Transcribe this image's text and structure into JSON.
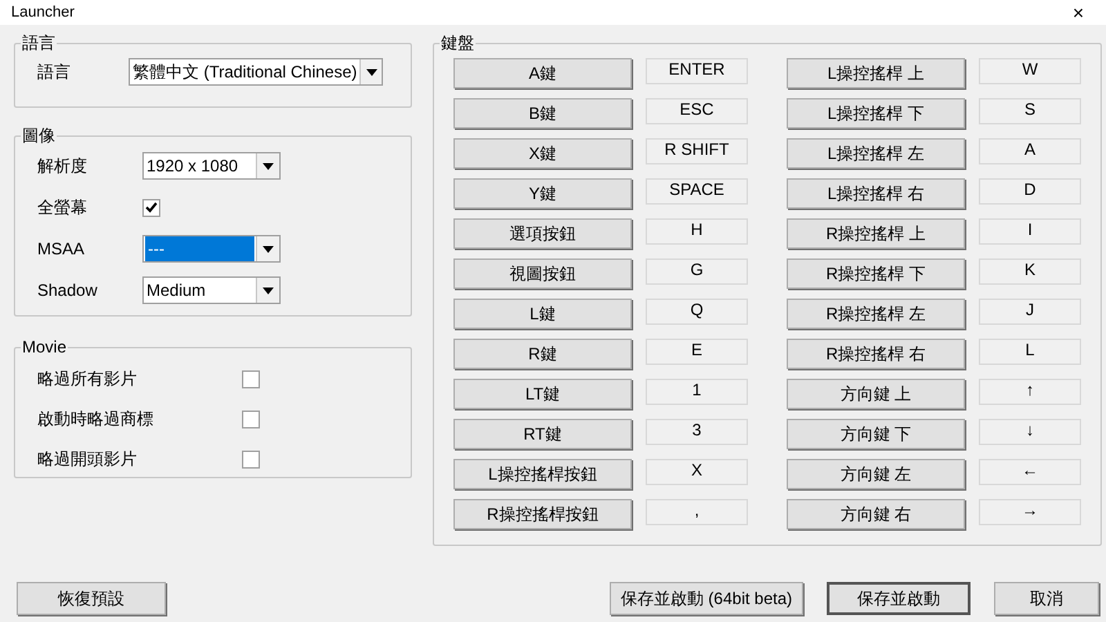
{
  "window": {
    "title": "Launcher",
    "close": "×"
  },
  "language": {
    "legend": "語言",
    "label": "語言",
    "value": "繁體中文 (Traditional Chinese)",
    "highlighted": false
  },
  "graphics": {
    "legend": "圖像",
    "fields": [
      {
        "kind": "dropdown",
        "label": "解析度",
        "value": "1920 x 1080",
        "highlighted": false
      },
      {
        "kind": "checkbox",
        "label": "全螢幕",
        "checked": true
      },
      {
        "kind": "dropdown",
        "label": "MSAA",
        "value": "---",
        "highlighted": true
      },
      {
        "kind": "dropdown",
        "label": "Shadow",
        "value": "Medium",
        "highlighted": false
      }
    ]
  },
  "movie": {
    "legend": "Movie",
    "options": [
      {
        "label": "略過所有影片",
        "checked": false
      },
      {
        "label": "啟動時略過商標",
        "checked": false
      },
      {
        "label": "略過開頭影片",
        "checked": false
      }
    ]
  },
  "keyboard": {
    "legend": "鍵盤",
    "columns": [
      [
        {
          "action": "A鍵",
          "key": "ENTER"
        },
        {
          "action": "B鍵",
          "key": "ESC"
        },
        {
          "action": "X鍵",
          "key": "R SHIFT"
        },
        {
          "action": "Y鍵",
          "key": "SPACE"
        },
        {
          "action": "選項按鈕",
          "key": "H"
        },
        {
          "action": "視圖按鈕",
          "key": "G"
        },
        {
          "action": "L鍵",
          "key": "Q"
        },
        {
          "action": "R鍵",
          "key": "E"
        },
        {
          "action": "LT鍵",
          "key": "1"
        },
        {
          "action": "RT鍵",
          "key": "3"
        },
        {
          "action": "L操控搖桿按鈕",
          "key": "X"
        },
        {
          "action": "R操控搖桿按鈕",
          "key": ","
        }
      ],
      [
        {
          "action": "L操控搖桿 上",
          "key": "W"
        },
        {
          "action": "L操控搖桿 下",
          "key": "S"
        },
        {
          "action": "L操控搖桿 左",
          "key": "A"
        },
        {
          "action": "L操控搖桿 右",
          "key": "D"
        },
        {
          "action": "R操控搖桿 上",
          "key": "I"
        },
        {
          "action": "R操控搖桿 下",
          "key": "K"
        },
        {
          "action": "R操控搖桿 左",
          "key": "J"
        },
        {
          "action": "R操控搖桿 右",
          "key": "L"
        },
        {
          "action": "方向鍵 上",
          "key": "↑"
        },
        {
          "action": "方向鍵 下",
          "key": "↓"
        },
        {
          "action": "方向鍵 左",
          "key": "←"
        },
        {
          "action": "方向鍵 右",
          "key": "→"
        }
      ]
    ]
  },
  "buttons": {
    "reset": "恢復預設",
    "save_64": "保存並啟動 (64bit beta)",
    "save": "保存並啟動",
    "cancel": "取消"
  }
}
